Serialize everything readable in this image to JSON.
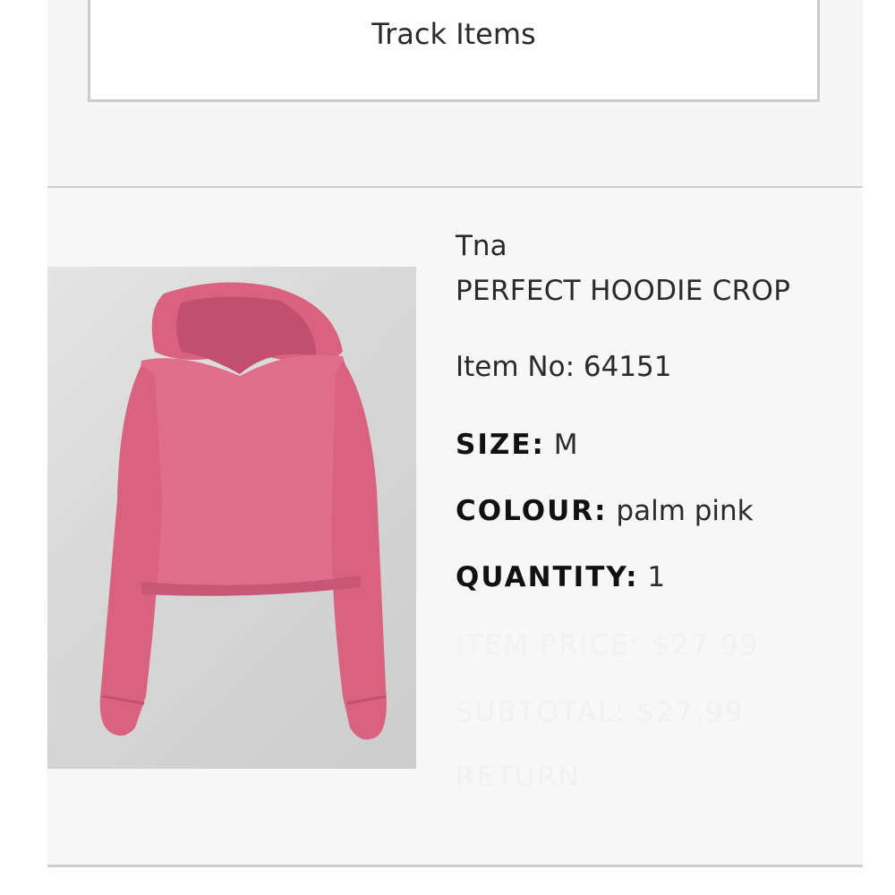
{
  "tracking": {
    "button_label": "Track Items"
  },
  "product": {
    "brand": "Tna",
    "name": "PERFECT HOODIE CROP",
    "item_no": "Item No: 64151",
    "size_label": "SIZE:",
    "size_value": "M",
    "colour_label": "COLOUR:",
    "colour_value": "palm pink",
    "quantity_label": "QUANTITY:",
    "quantity_value": "1",
    "item_price": "ITEM PRICE: $27.99",
    "subtotal": "SUBTOTAL: $27.99",
    "return_label": "RETURN",
    "image_icon": "pink-cropped-hoodie",
    "hoodie_color": "#e06d8a"
  }
}
